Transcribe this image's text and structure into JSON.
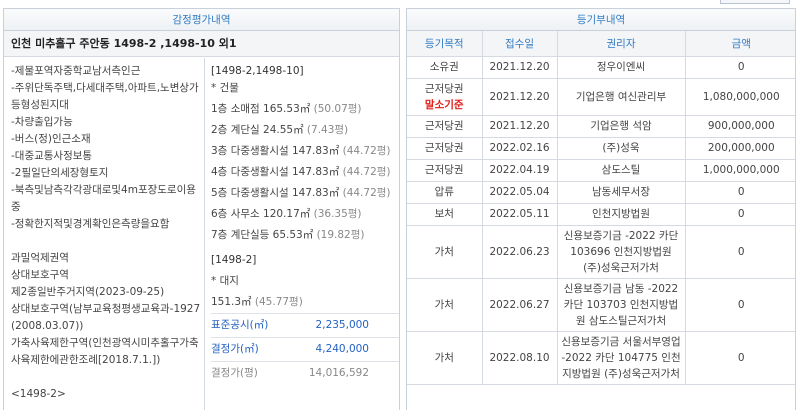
{
  "left": {
    "header": "감정평가내역",
    "title": "인천 미추홀구 주안동 1498-2 ,1498-10 외1",
    "conditions": [
      "-제물포역자중학교남서측인근",
      "-주위단독주택,다세대주택,아파트,노변상가등형성된지대",
      "-차량출입가능",
      "-버스(정)인근소재",
      "-대중교통사정보통",
      "-2필일단의세장형토지",
      "-북측및남측각각광대로및4m포장도로이용중",
      "-정확한지적및경계확인은측량을요함"
    ],
    "zoning": [
      "과밀억제권역",
      "상대보호구역",
      "제2종일반주거지역(2023-09-25)",
      "상대보호구역(남부교육청평생교육과-1927(2008.03.07))",
      "가축사육제한구역(인천광역시미추홀구가축사육제한에관한조례[2018.7.1.])"
    ],
    "footer_lot": "<1498-2>",
    "building": {
      "lot": "[1498-2,1498-10]",
      "label": "* 건물",
      "floors": [
        {
          "f": "1층",
          "use": "소매점",
          "area": "165.53㎡",
          "py": "(50.07평)"
        },
        {
          "f": "2층",
          "use": "계단실",
          "area": "24.55㎡",
          "py": "(7.43평)"
        },
        {
          "f": "3층",
          "use": "다중생활시설",
          "area": "147.83㎡",
          "py": "(44.72평)"
        },
        {
          "f": "4층",
          "use": "다중생활시설",
          "area": "147.83㎡",
          "py": "(44.72평)"
        },
        {
          "f": "5층",
          "use": "다중생활시설",
          "area": "147.83㎡",
          "py": "(44.72평)"
        },
        {
          "f": "6층",
          "use": "사무소",
          "area": "120.17㎡",
          "py": "(36.35평)"
        },
        {
          "f": "7층",
          "use": "계단실등",
          "area": "65.53㎡",
          "py": "(19.82평)"
        }
      ]
    },
    "land": {
      "lot": "[1498-2]",
      "label": "* 대지",
      "area": "151.3㎡",
      "py": "(45.77평)",
      "official_label": "표준공시(㎡)",
      "official_value": "2,235,000",
      "decided_label": "결정가(㎡)",
      "decided_value": "4,240,000",
      "decided_py_label": "결정가(평)",
      "decided_py_value": "14,016,592"
    }
  },
  "right": {
    "header": "등기부내역",
    "columns": [
      "등기목적",
      "접수일",
      "권리자",
      "금액"
    ],
    "rows": [
      {
        "type": "소유권",
        "date": "2021.12.20",
        "holder": "정우이엔씨",
        "amount": "0"
      },
      {
        "type": "근저당권",
        "sub": "말소기준",
        "date": "2021.12.20",
        "holder": "기업은행 여신관리부",
        "amount": "1,080,000,000"
      },
      {
        "type": "근저당권",
        "date": "2021.12.20",
        "holder": "기업은행 석암",
        "amount": "900,000,000"
      },
      {
        "type": "근저당권",
        "date": "2022.02.16",
        "holder": "(주)성욱",
        "amount": "200,000,000"
      },
      {
        "type": "근저당권",
        "date": "2022.04.19",
        "holder": "삼도스틸",
        "amount": "1,000,000,000"
      },
      {
        "type": "압류",
        "date": "2022.05.04",
        "holder": "남동세무서장",
        "amount": "0"
      },
      {
        "type": "보처",
        "date": "2022.05.11",
        "holder": "인천지방법원",
        "amount": "0"
      },
      {
        "type": "가처",
        "date": "2022.06.23",
        "holder": "신용보증기금 -2022 카단 103696 인천지방법원 (주)성욱근저가처",
        "amount": "0"
      },
      {
        "type": "가처",
        "date": "2022.06.27",
        "holder": "신용보증기금 남동 -2022 카단 103703 인천지방법원 삼도스틸근저가처",
        "amount": "0"
      },
      {
        "type": "가처",
        "date": "2022.08.10",
        "holder": "신용보증기금 서울서부영업 -2022 카단 104775 인천지방법원 (주)성욱근저가처",
        "amount": "0"
      }
    ]
  }
}
